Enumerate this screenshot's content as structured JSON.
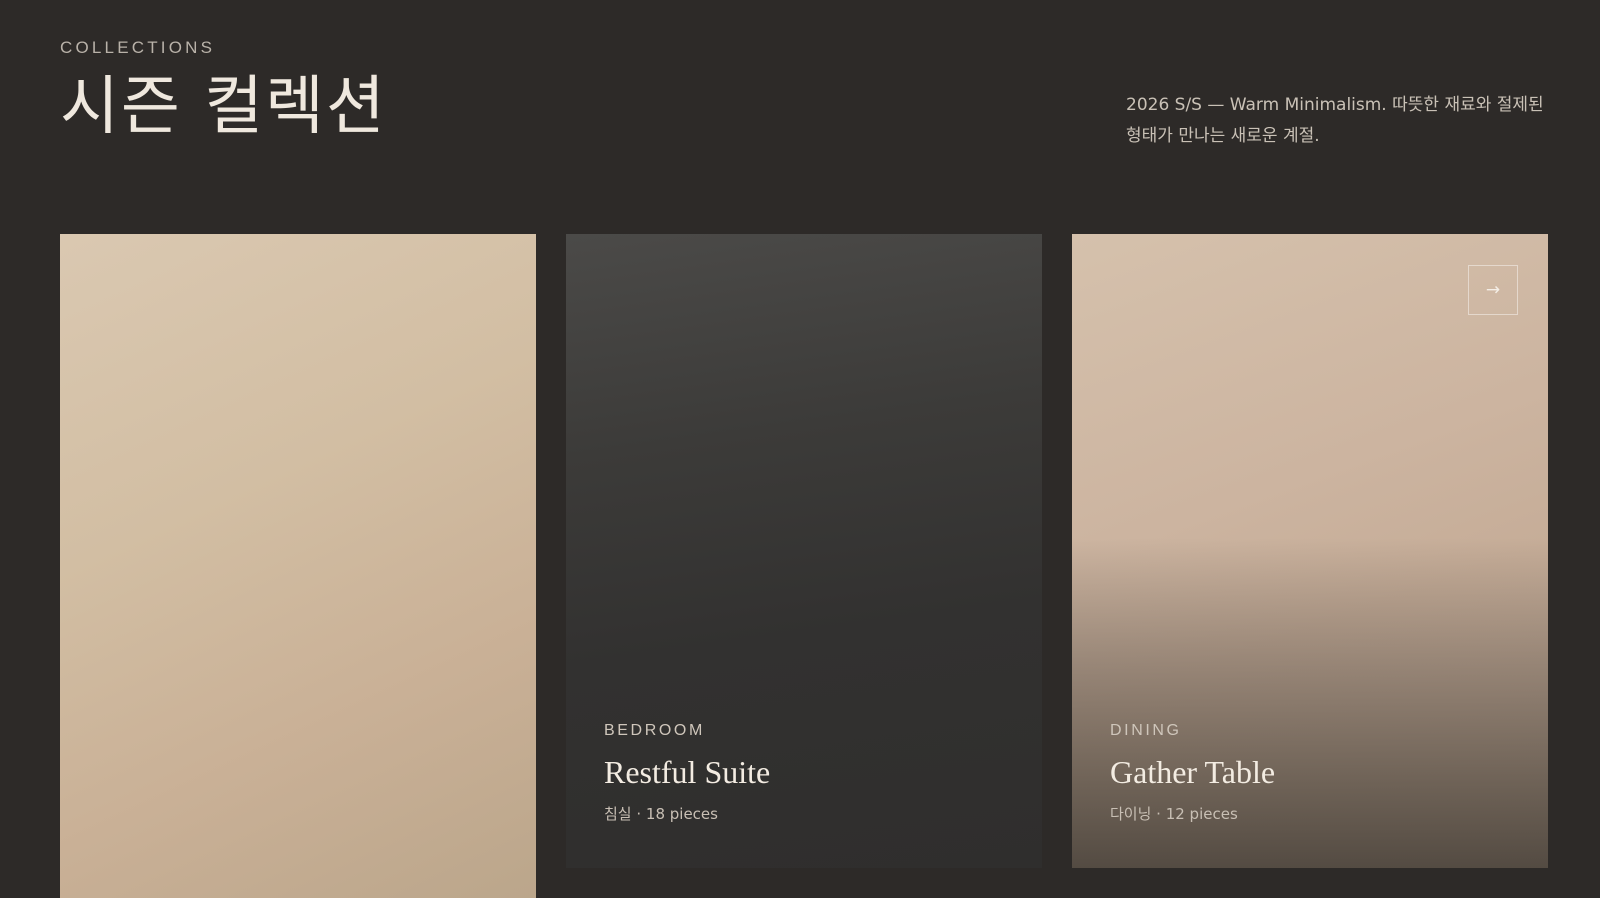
{
  "header": {
    "eyebrow": "COLLECTIONS",
    "title": "시즌 컬렉션",
    "intro": "2026 S/S — Warm Minimalism. 따뜻한 재료와 절제된 형태가 만나는 새로운 계절."
  },
  "cards": [
    {},
    {
      "category": "BEDROOM",
      "name": "Restful Suite",
      "meta": "침실 · 18 pieces"
    },
    {
      "category": "DINING",
      "name": "Gather Table",
      "meta": "다이닝 · 12 pieces",
      "arrow_icon": "arrow-right-icon",
      "arrow_glyph": "→"
    }
  ],
  "colors": {
    "background": "#2d2a28",
    "title": "#efe8de",
    "beige_card": "#d2bea3",
    "charcoal_card": "#3c3b39",
    "rose_card": "#ccb4a0"
  }
}
